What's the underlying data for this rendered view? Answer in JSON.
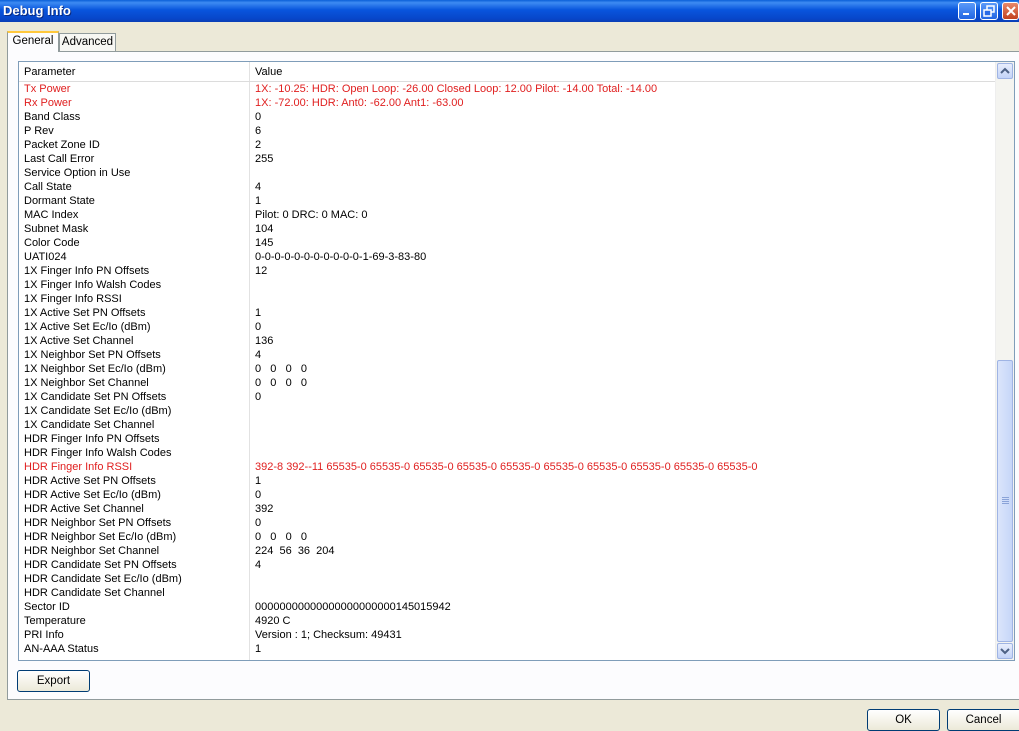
{
  "window": {
    "title": "Debug Info"
  },
  "tabs": [
    {
      "label": "General"
    },
    {
      "label": "Advanced"
    }
  ],
  "table": {
    "headers": {
      "parameter": "Parameter",
      "value": "Value"
    },
    "rows": [
      {
        "parameter": "Tx Power",
        "value": "1X: -10.25: HDR: Open Loop: -26.00 Closed Loop: 12.00 Pilot: -14.00 Total: -14.00",
        "highlight": true
      },
      {
        "parameter": "Rx Power",
        "value": "1X: -72.00: HDR: Ant0: -62.00 Ant1: -63.00",
        "highlight": true
      },
      {
        "parameter": "Band Class",
        "value": "0"
      },
      {
        "parameter": "P Rev",
        "value": "6"
      },
      {
        "parameter": "Packet Zone ID",
        "value": "2"
      },
      {
        "parameter": "Last Call Error",
        "value": "255"
      },
      {
        "parameter": "Service Option in Use",
        "value": ""
      },
      {
        "parameter": "Call State",
        "value": "4"
      },
      {
        "parameter": "Dormant State",
        "value": "1"
      },
      {
        "parameter": "MAC Index",
        "value": "Pilot: 0 DRC: 0 MAC: 0"
      },
      {
        "parameter": "Subnet Mask",
        "value": "104"
      },
      {
        "parameter": "Color Code",
        "value": "145"
      },
      {
        "parameter": "UATI024",
        "value": "0-0-0-0-0-0-0-0-0-0-0-1-69-3-83-80"
      },
      {
        "parameter": "1X Finger Info PN Offsets",
        "value": "12"
      },
      {
        "parameter": "1X Finger Info Walsh Codes",
        "value": ""
      },
      {
        "parameter": "1X Finger Info RSSI",
        "value": ""
      },
      {
        "parameter": "1X Active Set PN Offsets",
        "value": "1"
      },
      {
        "parameter": "1X Active Set Ec/Io (dBm)",
        "value": "0"
      },
      {
        "parameter": "1X Active Set Channel",
        "value": "136"
      },
      {
        "parameter": "1X Neighbor Set PN Offsets",
        "value": "4"
      },
      {
        "parameter": "1X Neighbor Set Ec/Io (dBm)",
        "value": "0   0   0   0"
      },
      {
        "parameter": "1X Neighbor Set Channel",
        "value": "0   0   0   0"
      },
      {
        "parameter": "1X Candidate Set PN Offsets",
        "value": "0"
      },
      {
        "parameter": "1X Candidate Set Ec/Io (dBm)",
        "value": ""
      },
      {
        "parameter": "1X Candidate Set Channel",
        "value": ""
      },
      {
        "parameter": "HDR Finger Info PN Offsets",
        "value": ""
      },
      {
        "parameter": "HDR Finger Info Walsh Codes",
        "value": ""
      },
      {
        "parameter": "HDR Finger Info RSSI",
        "value": "392-8 392--11 65535-0 65535-0 65535-0 65535-0 65535-0 65535-0 65535-0 65535-0 65535-0 65535-0",
        "highlight": true
      },
      {
        "parameter": "HDR Active Set PN Offsets",
        "value": "1"
      },
      {
        "parameter": "HDR Active Set Ec/Io (dBm)",
        "value": "0"
      },
      {
        "parameter": "HDR Active Set Channel",
        "value": "392"
      },
      {
        "parameter": "HDR Neighbor Set PN Offsets",
        "value": "0"
      },
      {
        "parameter": "HDR Neighbor Set Ec/Io (dBm)",
        "value": "0   0   0   0"
      },
      {
        "parameter": "HDR Neighbor Set Channel",
        "value": "224  56  36  204"
      },
      {
        "parameter": "HDR Candidate Set PN Offsets",
        "value": "4"
      },
      {
        "parameter": "HDR Candidate Set Ec/Io (dBm)",
        "value": ""
      },
      {
        "parameter": "HDR Candidate Set Channel",
        "value": ""
      },
      {
        "parameter": "Sector ID",
        "value": "00000000000000000000000145015942"
      },
      {
        "parameter": "Temperature",
        "value": "4920 C"
      },
      {
        "parameter": "PRI Info",
        "value": "Version : 1; Checksum: 49431"
      },
      {
        "parameter": "AN-AAA Status",
        "value": "1"
      }
    ]
  },
  "buttons": {
    "export": "Export",
    "ok": "OK",
    "cancel": "Cancel"
  },
  "colors": {
    "highlight_text": "#e02020",
    "titlebar": "#0855dd",
    "dialog_bg": "#ece9d8"
  },
  "icons": {
    "minimize": "minimize-icon",
    "restore": "restore-icon",
    "close": "close-icon",
    "scroll_up": "chevron-up-icon",
    "scroll_down": "chevron-down-icon"
  }
}
